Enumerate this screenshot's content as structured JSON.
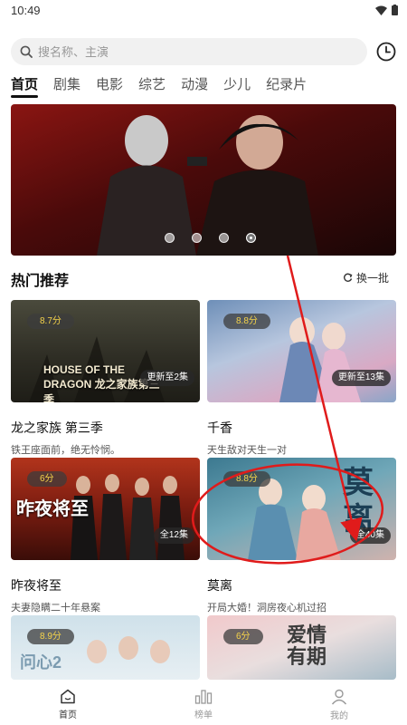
{
  "status": {
    "time": "10:49"
  },
  "search": {
    "placeholder": "搜名称、主演"
  },
  "tabs": [
    "首页",
    "剧集",
    "电影",
    "综艺",
    "动漫",
    "少儿",
    "纪录片"
  ],
  "banner": {
    "slide_count": 4,
    "active_slide": 4
  },
  "section": {
    "title": "热门推荐",
    "refresh_label": "换一批"
  },
  "cards": [
    {
      "title": "龙之家族 第三季",
      "subtitle": "铁王座面前，绝无怜悯。",
      "rating": "8.7分",
      "episodes": "更新至2集",
      "poster_text": "HOUSE OF THE DRAGON 龙之家族第三季"
    },
    {
      "title": "千香",
      "subtitle": "天生敌对天生一对",
      "rating": "8.8分",
      "episodes": "更新至13集",
      "poster_text": ""
    },
    {
      "title": "昨夜将至",
      "subtitle": "夫妻隐瞒二十年悬案",
      "rating": "6分",
      "episodes": "全12集",
      "poster_text": "昨夜将至"
    },
    {
      "title": "莫离",
      "subtitle": "开局大婚！洞房夜心机过招",
      "rating": "8.8分",
      "episodes": "全40集",
      "poster_text": "莫离"
    },
    {
      "title": "",
      "subtitle": "",
      "rating": "8.9分",
      "episodes": "",
      "poster_text": "问心2"
    },
    {
      "title": "",
      "subtitle": "",
      "rating": "6分",
      "episodes": "",
      "poster_text": "爱情有期"
    }
  ],
  "bottom_nav": [
    {
      "label": "首页",
      "icon": "home-icon",
      "active": true
    },
    {
      "label": "榜单",
      "icon": "chart-icon",
      "active": false
    },
    {
      "label": "我的",
      "icon": "user-icon",
      "active": false
    }
  ],
  "colors": {
    "accent": "#111111",
    "rating_text": "#f6d44a",
    "annotation_red": "#e01b1b"
  }
}
